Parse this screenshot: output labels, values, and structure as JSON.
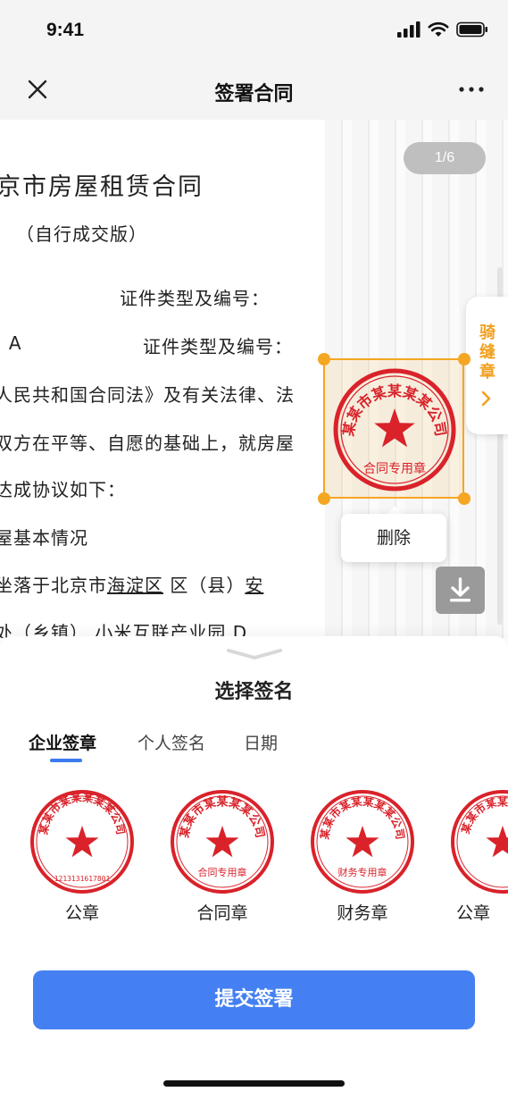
{
  "status_bar": {
    "time": "9:41"
  },
  "nav": {
    "title": "签署合同"
  },
  "document": {
    "page_indicator": "1/6",
    "lines": [
      {
        "text": "京市房屋租赁合同"
      },
      {
        "text": "（自行成交版）"
      },
      {
        "text": "证件类型及编号："
      },
      {
        "prefix": "i A",
        "suffix": "证件类型及编号："
      },
      {
        "text": "人民共和国合同法》及有关法律、法"
      },
      {
        "text": "双方在平等、自愿的基础上，就房屋"
      },
      {
        "text": "达成协议如下："
      },
      {
        "text": "屋基本情况"
      },
      {
        "prefix": "坐落于北京市",
        "district": "海淀区",
        "mid": "区（县）",
        "street": "安"
      },
      {
        "text": "处（乡镇）  小米互联产业园 D"
      }
    ],
    "riding_seam_label": "骑缝章",
    "placed_seal": {
      "top_text": "某某市某某某某公司",
      "bottom_text": "合同专用章"
    },
    "delete_label": "删除"
  },
  "sheet": {
    "title": "选择签名",
    "tabs": [
      {
        "label": "企业签章",
        "active": true
      },
      {
        "label": "个人签名",
        "active": false
      },
      {
        "label": "日期",
        "active": false
      }
    ],
    "stamps": [
      {
        "label": "公章",
        "top_text": "某某市某某某某某公司",
        "bottom_text": "",
        "code": "1213131617801"
      },
      {
        "label": "合同章",
        "top_text": "某某市某某某某公司",
        "bottom_text": "合同专用章",
        "code": ""
      },
      {
        "label": "财务章",
        "top_text": "某某市某某某某某公司",
        "bottom_text": "财务专用章",
        "code": ""
      },
      {
        "label": "公章",
        "top_text": "某某市某某某某公司",
        "bottom_text": "",
        "code": ""
      }
    ],
    "submit_label": "提交签署"
  },
  "colors": {
    "accent_blue": "#4480f2",
    "selection_orange": "#f5a623",
    "seal_red": "#d9222a"
  }
}
